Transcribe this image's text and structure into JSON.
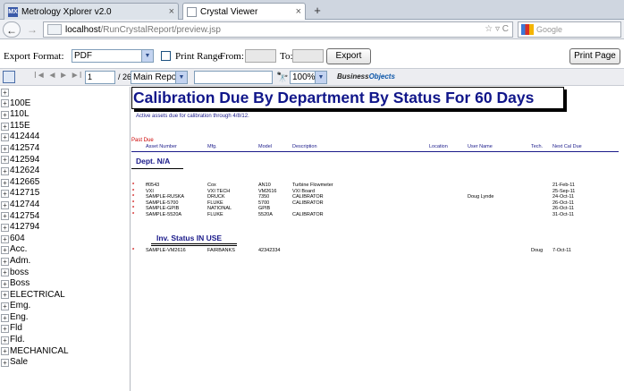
{
  "browser": {
    "tabs": [
      {
        "title": "Metrology Xplorer v2.0",
        "close": "×"
      },
      {
        "title": "Crystal Viewer",
        "close": "×"
      }
    ],
    "new_tab": "+",
    "back": "←",
    "forward": "→",
    "url_host": "localhost",
    "url_path": "/RunCrystalReport/preview.jsp",
    "url_icons": "☆ ▿ C",
    "search_placeholder": "Google"
  },
  "export": {
    "format_label": "Export Format:",
    "format_value": "PDF",
    "print_range_label": "Print Range",
    "from_label": "From:",
    "to_label": "To:",
    "export_button": "Export",
    "print_button": "Print Page"
  },
  "viewer": {
    "nav_icons": "I◄  ◄  ►  ►I",
    "page_value": "1",
    "page_total": "/ 26",
    "report_select": "Main Report",
    "zoom": "100%",
    "logo_business": "Business",
    "logo_objects": "Objects"
  },
  "tree": {
    "items": [
      "",
      "100E",
      "110L",
      "115E",
      "412444",
      "412574",
      "412594",
      "412624",
      "412665",
      "412715",
      "412744",
      "412754",
      "412794",
      "604",
      "Acc.",
      "Adm.",
      "boss",
      "Boss",
      "ELECTRICAL",
      "Emg.",
      "Eng.",
      "Fld",
      "Fld.",
      "MECHANICAL",
      "Sale"
    ]
  },
  "report": {
    "title": "Calibration Due By Department By Status For 60 Days",
    "subtitle": "Active assets due for calibration through 4/8/12.",
    "past_due": "Past Due",
    "columns": [
      "Asset Number",
      "Mfg.",
      "Model",
      "Description",
      "Location",
      "User Name",
      "Tech.",
      "Next Cal Due"
    ],
    "dept_label": "Dept.  N/A",
    "inv_status_label": "Inv. Status  IN USE",
    "rows_group1": [
      [
        "ff0543",
        "Cox",
        "AN10",
        "Turbine Flowmeter",
        "",
        "",
        "",
        "21-Feb-11"
      ],
      [
        "VXI",
        "VXI TECH",
        "VM2616",
        "VXI Board",
        "",
        "",
        "",
        "25-Sep-11"
      ],
      [
        "SAMPLE-RUSKA",
        "DRUCK",
        "7350",
        "CALIBRATOR",
        "",
        "Doug Lynde",
        "",
        "24-Oct-11"
      ],
      [
        "SAMPLE-5700",
        "FLUKE",
        "5700",
        "CALIBRATOR",
        "",
        "",
        "",
        "26-Oct-11"
      ],
      [
        "SAMPLE-GPIB",
        "NATIONAL",
        "GPIB",
        "",
        "",
        "",
        "",
        "26-Oct-11"
      ],
      [
        "SAMPLE-5520A",
        "FLUKE",
        "5520A",
        "CALIBRATOR",
        "",
        "",
        "",
        "31-Oct-11"
      ]
    ],
    "rows_group2": [
      [
        "SAMPLE-VM2616",
        "FAIRBANKS",
        "42342334",
        "",
        "",
        "",
        "Doug",
        "7-Oct-11"
      ]
    ]
  }
}
